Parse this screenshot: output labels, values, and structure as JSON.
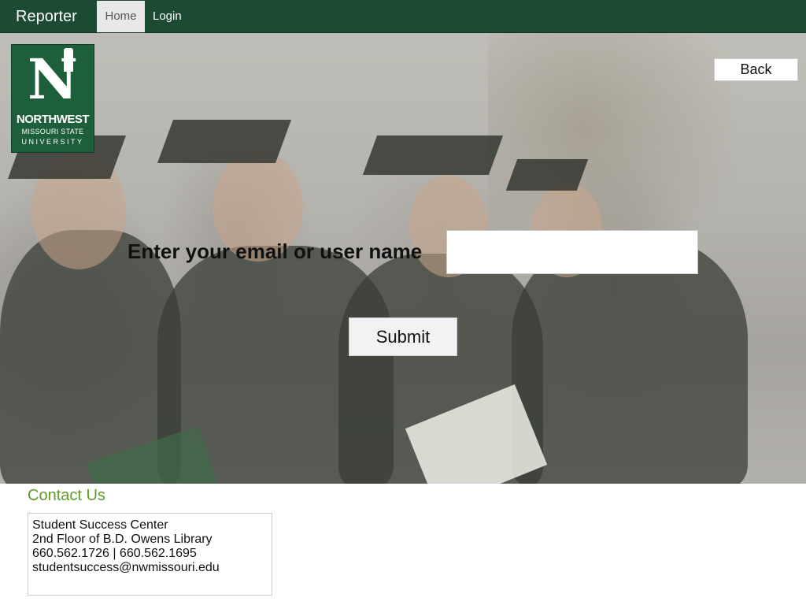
{
  "navbar": {
    "brand": "Reporter",
    "items": [
      {
        "label": "Home",
        "active": true
      },
      {
        "label": "Login",
        "active": false
      }
    ]
  },
  "logo": {
    "line1": "NORTHWEST",
    "line2": "MISSOURI STATE",
    "line3": "UNIVERSITY",
    "letter": "N"
  },
  "hero": {
    "back_label": "Back",
    "email_label": "Enter your email or user name",
    "email_value": "",
    "submit_label": "Submit"
  },
  "contact": {
    "title": "Contact Us",
    "lines": [
      "Student Success Center",
      "2nd Floor of B.D. Owens Library",
      "660.562.1726 | 660.562.1695",
      "studentsuccess@nwmissouri.edu"
    ]
  },
  "colors": {
    "navbar_bg": "#1c4a33",
    "contact_title": "#5f9a2a",
    "logo_bg": "#1c5f3a"
  }
}
